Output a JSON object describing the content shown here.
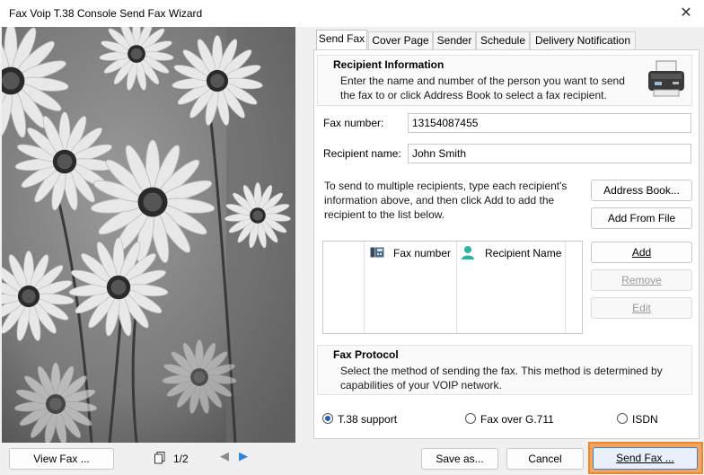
{
  "window": {
    "title": "Fax Voip T.38 Console Send Fax Wizard",
    "close_glyph": "✕"
  },
  "preview": {
    "page_indicator": "1/2",
    "view_fax_label": "View Fax ...",
    "prev_glyph": "◀",
    "next_glyph": "▶"
  },
  "tabs": [
    {
      "label": "Send Fax",
      "active": true
    },
    {
      "label": "Cover Page"
    },
    {
      "label": "Sender"
    },
    {
      "label": "Schedule"
    },
    {
      "label": "Delivery Notification"
    }
  ],
  "recipient_info": {
    "title": "Recipient Information",
    "description": "Enter the name and number of the person you want to send the fax to or click Address Book to select a fax recipient."
  },
  "form": {
    "fax_number_label": "Fax number:",
    "fax_number_value": "13154087455",
    "recipient_name_label": "Recipient name:",
    "recipient_name_value": "John Smith",
    "multi_hint": "To send to multiple recipients, type each recipient's information above, and then click Add to add the recipient to the list below."
  },
  "buttons": {
    "address_book": "Address Book...",
    "add_from_file": "Add From File",
    "add": "Add",
    "remove": "Remove",
    "edit": "Edit",
    "save_as": "Save as...",
    "cancel": "Cancel",
    "send_fax": "Send Fax ..."
  },
  "recipient_list": {
    "columns": [
      "Fax number",
      "Recipient Name"
    ]
  },
  "protocol": {
    "title": "Fax Protocol",
    "description": "Select the method of sending the fax. This method is determined by capabilities of your VOIP network.",
    "options": [
      {
        "label": "T.38 support",
        "selected": true
      },
      {
        "label": "Fax over G.711",
        "selected": false
      },
      {
        "label": "ISDN",
        "selected": false
      }
    ]
  },
  "icons": {
    "fax_machine": "fax-machine-icon",
    "fax_column": "fax-number-column-icon",
    "recipient_column": "person-icon",
    "page": "page-icon"
  },
  "colors": {
    "accent_blue": "#3f7fd0",
    "send_highlight": "#f4a460",
    "person_icon": "#2bb5a0"
  }
}
